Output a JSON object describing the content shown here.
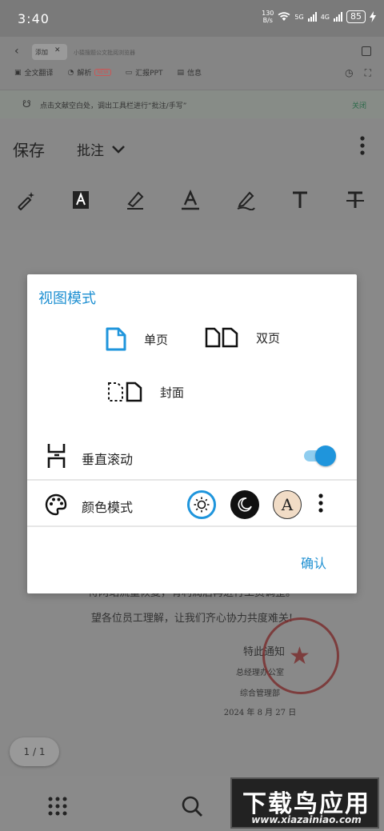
{
  "status": {
    "time": "3:40",
    "net_speed_value": "130",
    "net_speed_unit": "B/s",
    "signal_1": "5G",
    "signal_2": "4G",
    "battery": "85"
  },
  "browser": {
    "tab_active": "添加",
    "tab_other": "小猿搜题公文批阅浏览器",
    "tools": [
      {
        "label": "全文翻译"
      },
      {
        "label": "解析",
        "badge": "NEW"
      },
      {
        "label": "汇报PPT"
      },
      {
        "label": "信息"
      }
    ]
  },
  "hint": {
    "text": "点击文献空白处，调出工具栏进行“批注/手写”",
    "close": "关闭"
  },
  "toolbar": {
    "save": "保存",
    "mode": "批注"
  },
  "document": {
    "lines": [
      "待网站流量恢复，有利润后再进行工资调整。",
      "望各位员工理解，让我们齐心协力共度难关!",
      "特此通知",
      "总经理办公室",
      "综合管理部",
      "2024 年 8 月 27 日"
    ],
    "page_indicator": "1 / 1"
  },
  "watermark": {
    "title": "下载鸟应用",
    "url": "www.xiazainiao.com"
  },
  "dialog": {
    "title": "视图模式",
    "single": "单页",
    "double": "双页",
    "cover": "封面",
    "scroll": "垂直滚动",
    "scroll_on": true,
    "color_mode": "颜色模式",
    "sepia_letter": "A",
    "confirm": "确认",
    "accent": "#1f95dc"
  }
}
